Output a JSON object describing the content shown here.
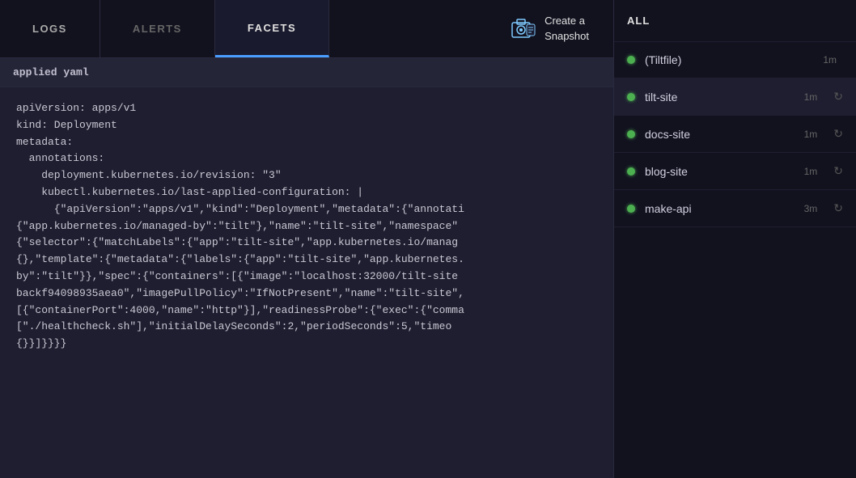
{
  "tabs": [
    {
      "id": "logs",
      "label": "LOGS",
      "active": false
    },
    {
      "id": "alerts",
      "label": "ALERTS",
      "active": false
    },
    {
      "id": "facets",
      "label": "FACETS",
      "active": true
    }
  ],
  "create_snapshot": {
    "label_line1": "Create a",
    "label_line2": "Snapshot"
  },
  "content_header": "applied yaml",
  "code_content": "apiVersion: apps/v1\nkind: Deployment\nmetadata:\n  annotations:\n    deployment.kubernetes.io/revision: \"3\"\n    kubectl.kubernetes.io/last-applied-configuration: |\n      {\"apiVersion\":\"apps/v1\",\"kind\":\"Deployment\",\"metadata\":{\"annotati\n{\"app.kubernetes.io/managed-by\":\"tilt\"},\"name\":\"tilt-site\",\"namespace\"\n{\"selector\":{\"matchLabels\":{\"app\":\"tilt-site\",\"app.kubernetes.io/manag\n{},\"template\":{\"metadata\":{\"labels\":{\"app\":\"tilt-site\",\"app.kubernetes.\nby\":\"tilt\"}},\"spec\":{\"containers\":[{\"image\":\"localhost:32000/tilt-site\nbackf94098935aea0\",\"imagePullPolicy\":\"IfNotPresent\",\"name\":\"tilt-site\",\n[{\"containerPort\":4000,\"name\":\"http\"}],\"readinessProbe\":{\"exec\":{\"comma\n[\"./healthcheck.sh\"],\"initialDelaySeconds\":2,\"periodSeconds\":5,\"timeo\n{}}]}}}}",
  "sidebar": {
    "all_label": "ALL",
    "items": [
      {
        "id": "tiltfile",
        "name": "(Tiltfile)",
        "status": "green",
        "time": "1m",
        "active": false
      },
      {
        "id": "tilt-site",
        "name": "tilt-site",
        "status": "green",
        "time": "1m",
        "active": true
      },
      {
        "id": "docs-site",
        "name": "docs-site",
        "status": "green",
        "time": "1m",
        "active": false
      },
      {
        "id": "blog-site",
        "name": "blog-site",
        "status": "green",
        "time": "1m",
        "active": false
      },
      {
        "id": "make-api",
        "name": "make-api",
        "status": "green",
        "time": "3m",
        "active": false
      }
    ]
  }
}
